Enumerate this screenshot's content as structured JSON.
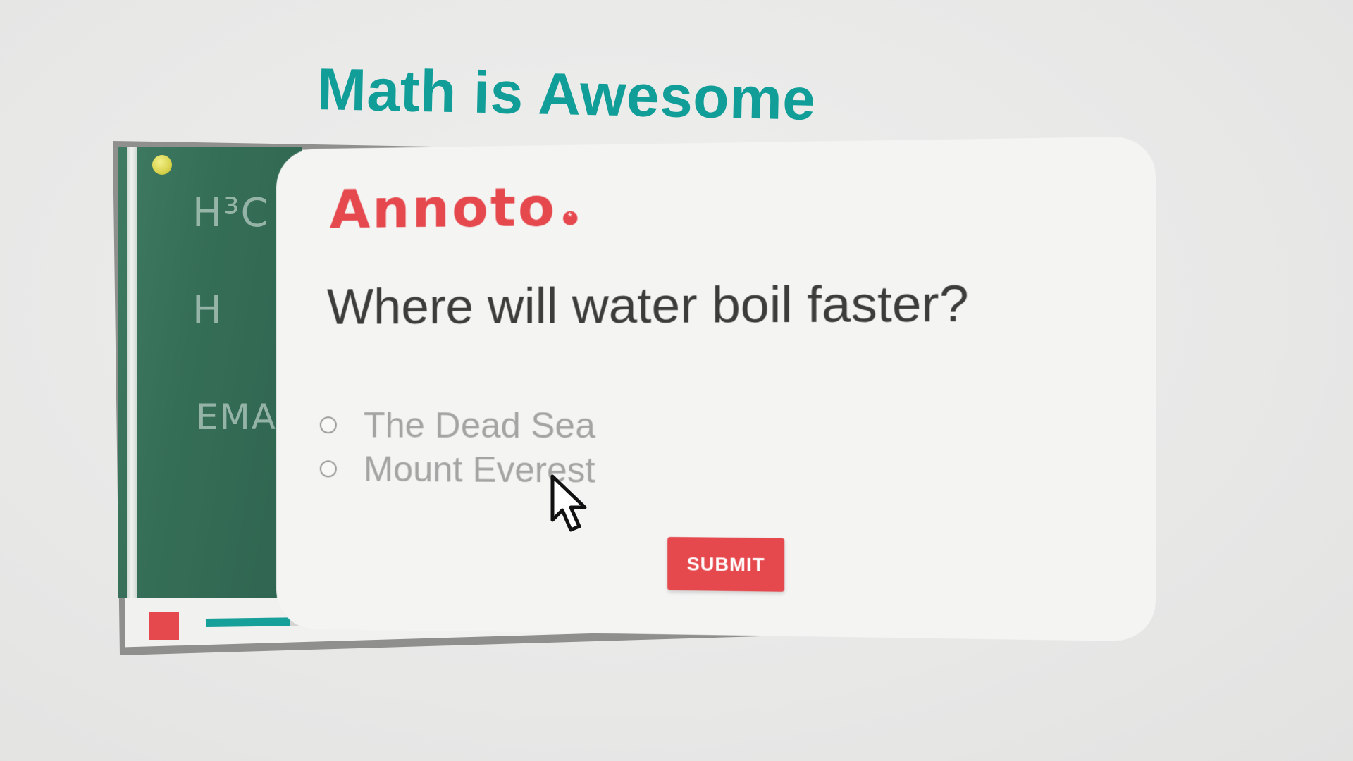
{
  "video": {
    "title": "Math is Awesome",
    "progress": 0.12,
    "chalkboard_text": [
      "H³C",
      "H",
      "EMAN"
    ]
  },
  "controls": {
    "stop_icon": "stop-icon"
  },
  "quiz": {
    "logo_text": "Annoto",
    "question": "Where will water boil faster?",
    "options": [
      {
        "label": "The Dead Sea",
        "selected": false
      },
      {
        "label": "Mount Everest",
        "selected": false
      }
    ],
    "submit_label": "SUBMIT"
  },
  "colors": {
    "accent_red": "#e5484d",
    "accent_teal": "#129e98",
    "chalkboard_green": "#356e57"
  }
}
